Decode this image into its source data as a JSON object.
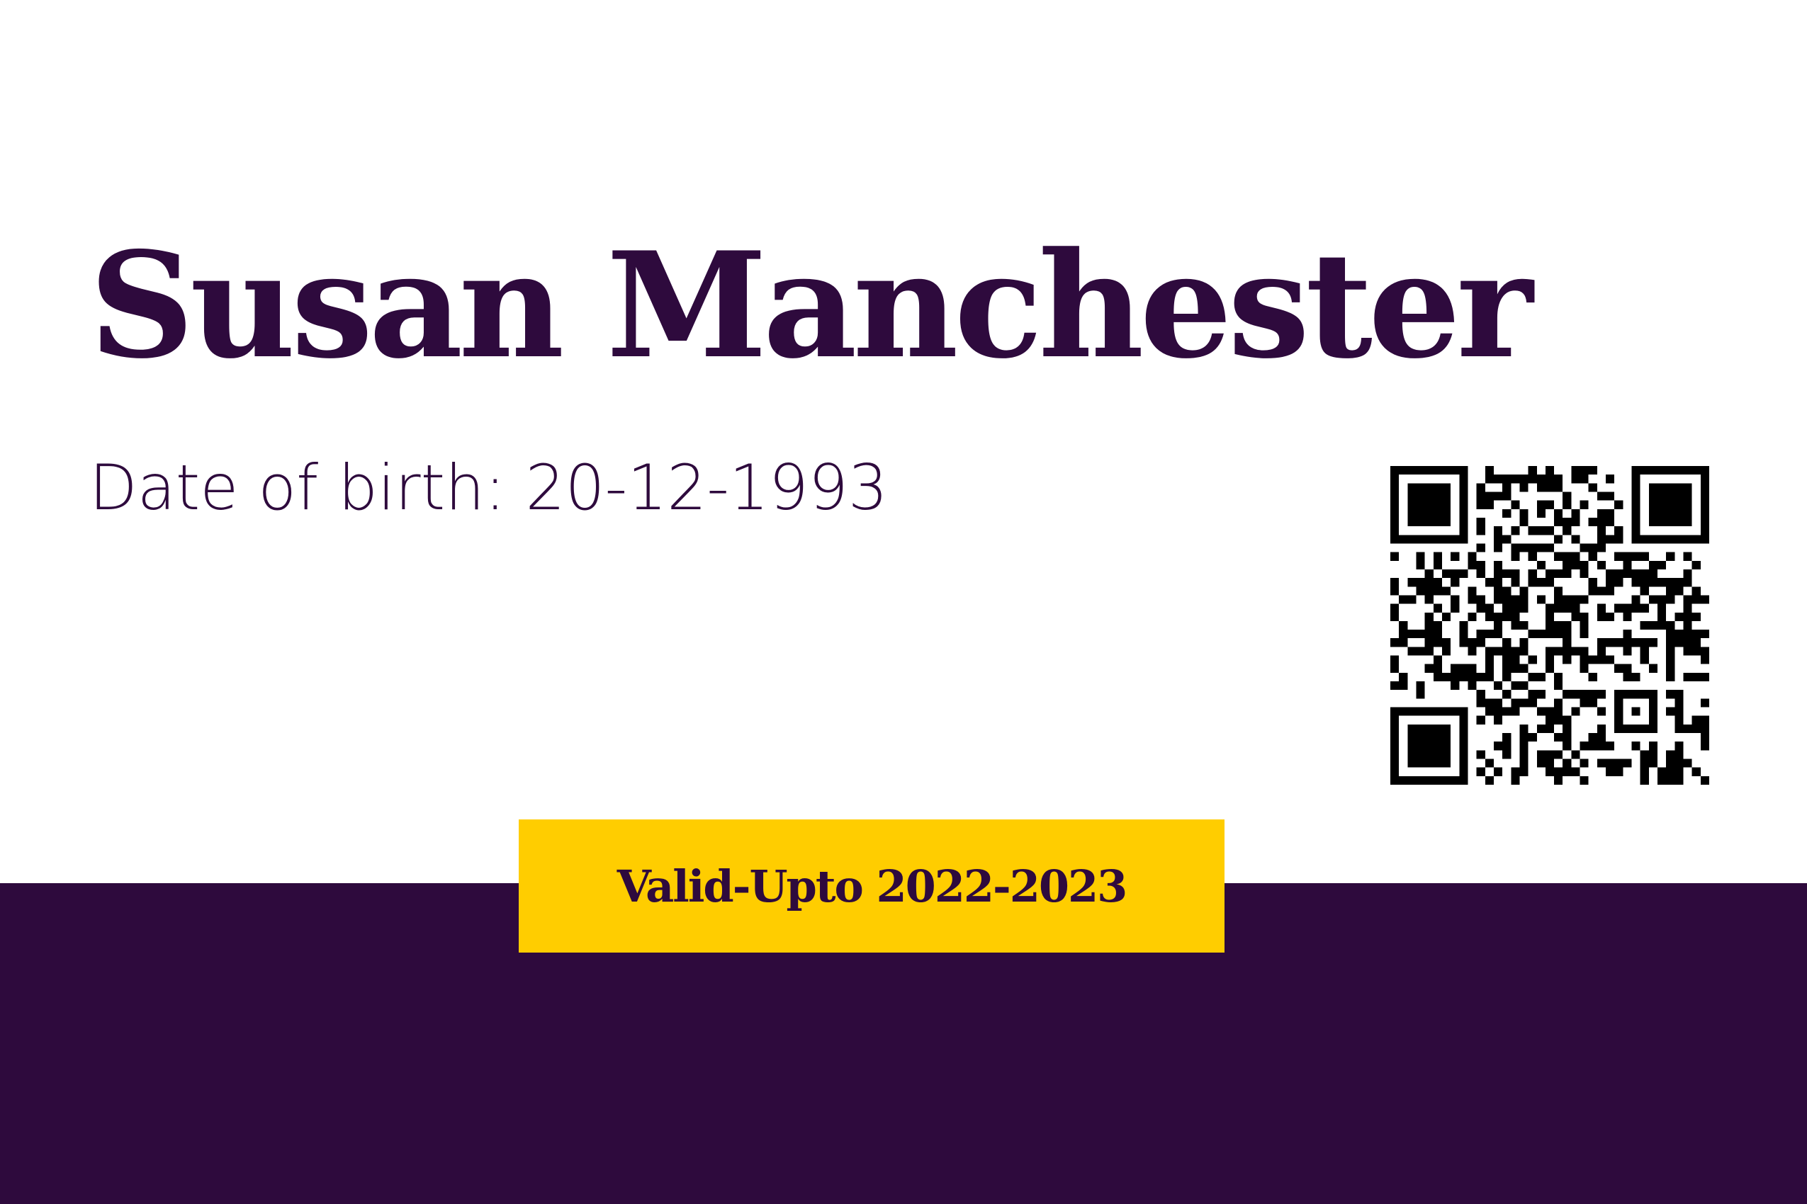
{
  "card": {
    "holder_name": "Susan Manchester",
    "date_of_birth": "Date of birth: 20-12-1993",
    "validity": "Valid-Upto 2022-2023",
    "qr_icon": "qr-code-icon"
  },
  "colors": {
    "primary": "#2e0a3d",
    "accent": "#ffcd00",
    "background": "#ffffff"
  }
}
